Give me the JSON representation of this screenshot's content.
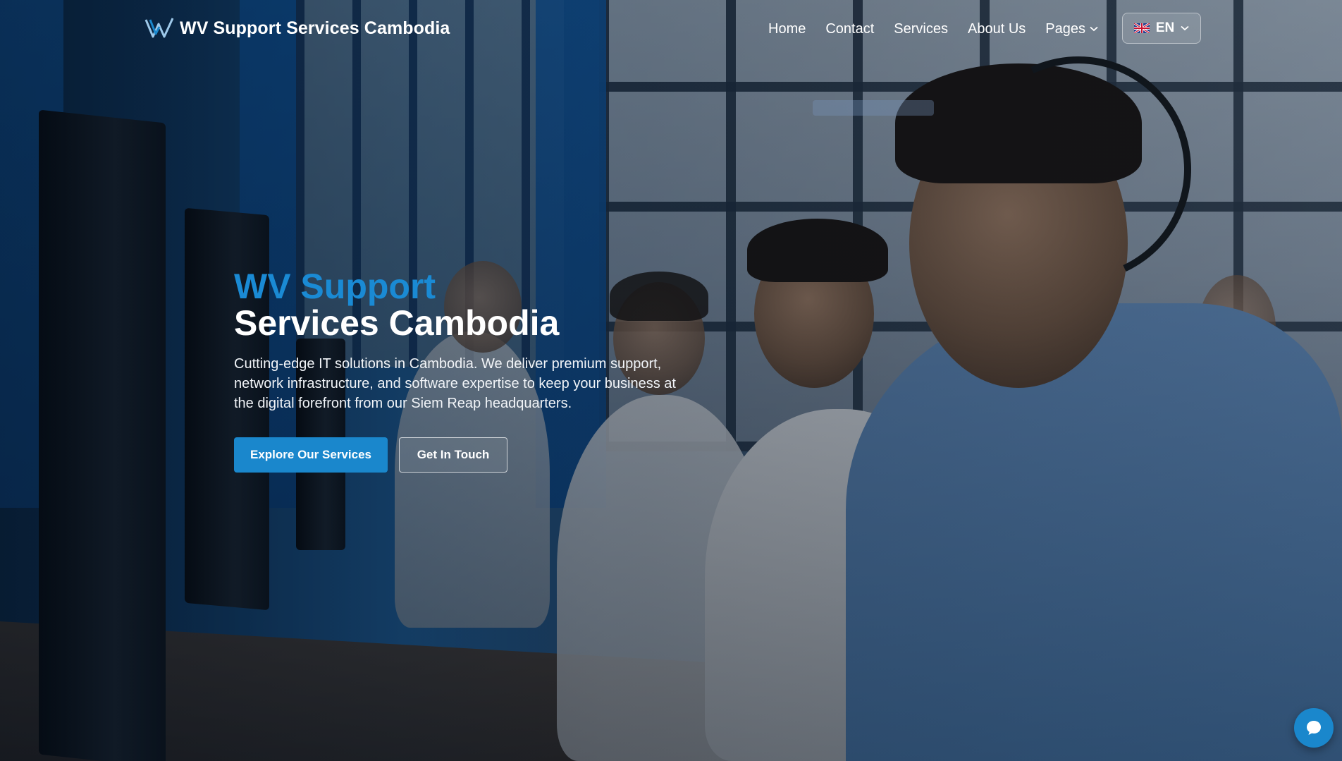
{
  "brand": {
    "name": "WV Support Services Cambodia",
    "logo_icon": "wv-logo-icon"
  },
  "nav": {
    "items": [
      {
        "label": "Home"
      },
      {
        "label": "Contact"
      },
      {
        "label": "Services"
      },
      {
        "label": "About Us"
      },
      {
        "label": "Pages",
        "has_dropdown": true
      }
    ],
    "language": {
      "code": "EN",
      "flag_icon": "uk-flag-icon"
    }
  },
  "hero": {
    "title_line_1": "WV Support",
    "title_line_2": "Services Cambodia",
    "description": "Cutting-edge IT solutions in Cambodia. We deliver premium support, network infrastructure, and software expertise to keep your business at the digital forefront from our Siem Reap headquarters.",
    "primary_button": "Explore Our Services",
    "secondary_button": "Get In Touch"
  },
  "chat": {
    "icon": "chat-bubble-icon"
  },
  "colors": {
    "accent": "#1a87cc",
    "title_accent": "#1a8ad4",
    "text": "#ffffff"
  }
}
